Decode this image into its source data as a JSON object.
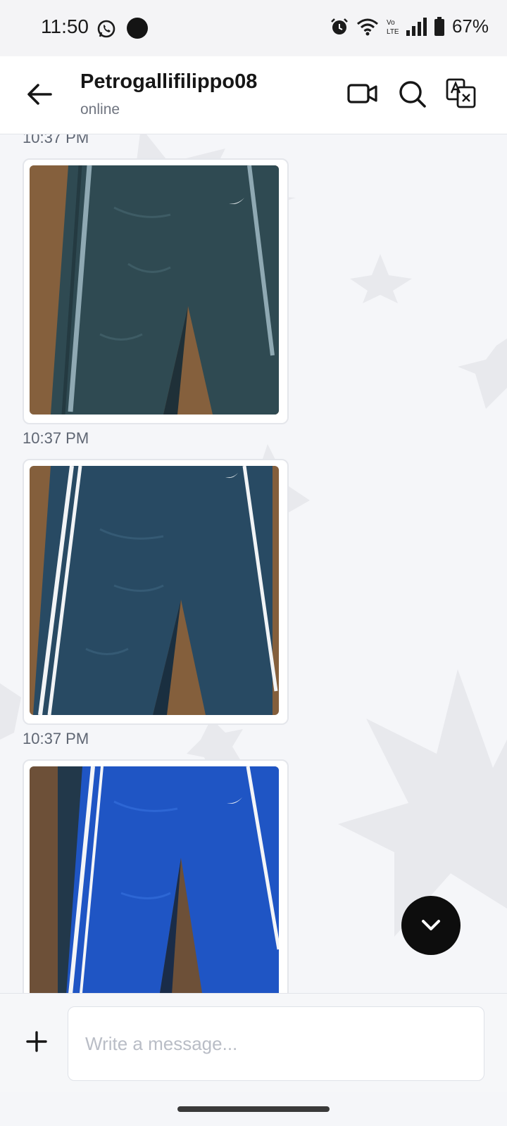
{
  "status_bar": {
    "time": "11:50",
    "battery": "67%",
    "network_badge": "Vo LTE"
  },
  "header": {
    "contact_name": "Petrogallifilippo08",
    "contact_status": "online"
  },
  "messages": [
    {
      "time": "10:37 PM",
      "photo": "dark-green-track-pants"
    },
    {
      "time": "10:37 PM",
      "photo": "navy-track-pants"
    },
    {
      "time": "10:37 PM",
      "photo": "blue-track-pants"
    }
  ],
  "composer": {
    "placeholder": "Write a message..."
  },
  "icons": {
    "back": "arrow-left-icon",
    "video": "video-camera-icon",
    "search": "search-icon",
    "translate": "translate-icon",
    "scroll": "chevron-down-icon",
    "attach": "plus-icon"
  },
  "colors": {
    "accent_dark": "#0d0d0d",
    "background": "#f5f6f9"
  }
}
